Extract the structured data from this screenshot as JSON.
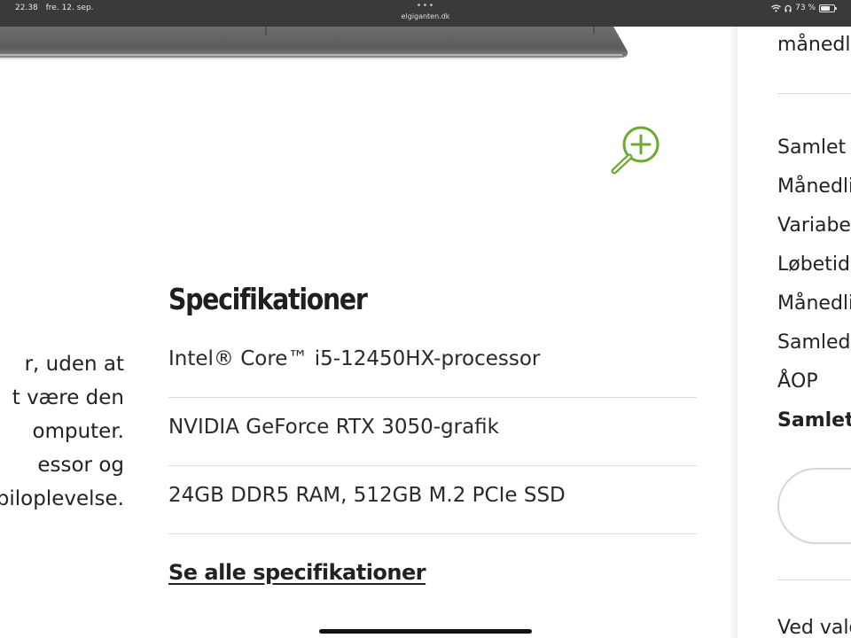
{
  "status_bar": {
    "time": "22.38",
    "date": "fre. 12. sep.",
    "url": "elgiganten.dk",
    "battery": "73 %",
    "battery_level": 0.73
  },
  "specs": {
    "title": "Specifikationer",
    "items": [
      "Intel® Core™ i5-12450HX-processor",
      "NVIDIA GeForce RTX 3050-grafik",
      "24GB DDR5 RAM, 512GB M.2 PCIe SSD"
    ],
    "see_all": "Se alle specifikationer"
  },
  "description_lines": [
    "r, uden at",
    "t være den",
    "omputer.",
    "essor og",
    "biloplevelse."
  ],
  "side_panel": {
    "top_text": "månedli",
    "rows": [
      "Samlet k",
      "Månedli",
      "Variabel",
      "Løbetid",
      "Månedli",
      "Samlede",
      "ÅOP"
    ],
    "bold_row": "Samlet t",
    "bottom_text": "Ved valg"
  },
  "colors": {
    "status_bar": "#3a3a3c",
    "zoom_icon": "#6aab2e",
    "divider": "#dcdcdc"
  }
}
